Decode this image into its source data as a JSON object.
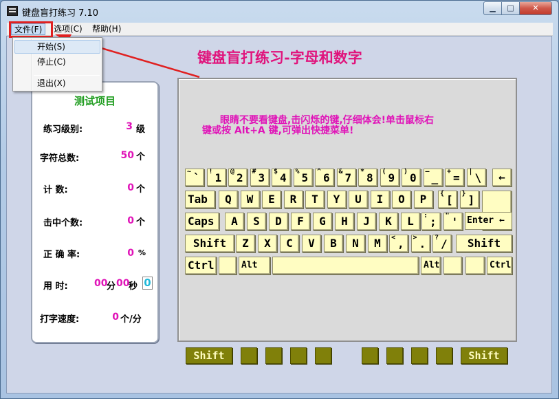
{
  "window": {
    "title": "键盘盲打练习 7.10",
    "min_label": "▭",
    "max_label": "□",
    "close_label": "✕"
  },
  "menu": {
    "file": "文件(F)",
    "options": "选项(C)",
    "help": "帮助(H)"
  },
  "file_menu": {
    "items": [
      "开始(S)",
      "停止(C)",
      "退出(X)"
    ]
  },
  "main_title": "键盘盲打练习-字母和数字",
  "stats": {
    "title": "测试项目",
    "level_label": "练习级别:",
    "level_value": "3",
    "level_unit": "级",
    "total_label": "字符总数:",
    "total_value": "50",
    "total_unit": "个",
    "count_label": "计    数:",
    "count_value": "0",
    "count_unit": "个",
    "hits_label": "击中个数:",
    "hits_value": "0",
    "hits_unit": "个",
    "accuracy_label": "正 确 率:",
    "accuracy_value": "0",
    "accuracy_unit": "%",
    "time_label": "用    时:",
    "time_min": "00",
    "time_min_unit": "分",
    "time_sec": "00",
    "time_sec_unit": "秒",
    "time_tick": "0",
    "speed_label": "打字速度:",
    "speed_value": "0",
    "speed_unit": "个/分"
  },
  "hint": {
    "line1": "眼睛不要看键盘,击闪烁的键,仔细体会!单击鼠标右",
    "line2": "键或按 Alt+A 键,可弹出快捷菜单!"
  },
  "keyboard": {
    "row1": [
      [
        "~",
        "`"
      ],
      [
        "!",
        "1"
      ],
      [
        "@",
        "2"
      ],
      [
        "#",
        "3"
      ],
      [
        "$",
        "4"
      ],
      [
        "%",
        "5"
      ],
      [
        "^",
        "6"
      ],
      [
        "&",
        "7"
      ],
      [
        "*",
        "8"
      ],
      [
        "(",
        "9"
      ],
      [
        ")",
        "0"
      ],
      [
        "—",
        "_"
      ],
      [
        "+",
        "="
      ],
      [
        "|",
        "\\"
      ]
    ],
    "backspace": "←",
    "tab": "Tab",
    "row2": [
      "Q",
      "W",
      "E",
      "R",
      "T",
      "Y",
      "U",
      "I",
      "O",
      "P"
    ],
    "row2_brackets": [
      [
        "{",
        "["
      ],
      [
        "}",
        "]"
      ]
    ],
    "enter": "Enter",
    "caps": "Caps",
    "row3": [
      "A",
      "S",
      "D",
      "F",
      "G",
      "H",
      "J",
      "K",
      "L"
    ],
    "row3_punct": [
      [
        ":",
        ";"
      ],
      [
        "\"",
        "'"
      ]
    ],
    "shift": "Shift",
    "row4": [
      "Z",
      "X",
      "C",
      "V",
      "B",
      "N",
      "M"
    ],
    "row4_punct": [
      [
        "<",
        ","
      ],
      [
        ">",
        "."
      ],
      [
        "?",
        "/"
      ]
    ],
    "ctrl": "Ctrl",
    "alt": "Alt"
  },
  "finger_bar": {
    "left_shift": "Shift",
    "right_shift": "Shift"
  },
  "colors": {
    "accent": "#e014b8",
    "title": "#e0147c",
    "key_face": "#fffdc2",
    "finger_key": "#80800a",
    "highlight": "#e02020"
  }
}
